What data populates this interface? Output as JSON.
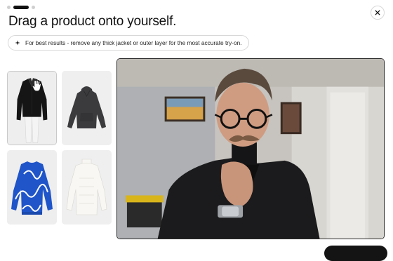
{
  "modal": {
    "title": "Drag a product onto yourself.",
    "hint": "For best results - remove any thick jacket or outer layer for the most accurate try-on.",
    "hint_icon": "sparkle-icon",
    "close_icon": "close-icon",
    "steps": {
      "total": 3,
      "current": 2
    }
  },
  "products": [
    {
      "name": "black blazer with white pants",
      "selected": true
    },
    {
      "name": "charcoal hoodie",
      "selected": false
    },
    {
      "name": "blue patterned sweater",
      "selected": false
    },
    {
      "name": "white turtleneck sweater",
      "selected": false
    }
  ],
  "colors": {
    "accent": "#111111",
    "border": "#d7d7d7",
    "card_bg": "#efefef"
  }
}
